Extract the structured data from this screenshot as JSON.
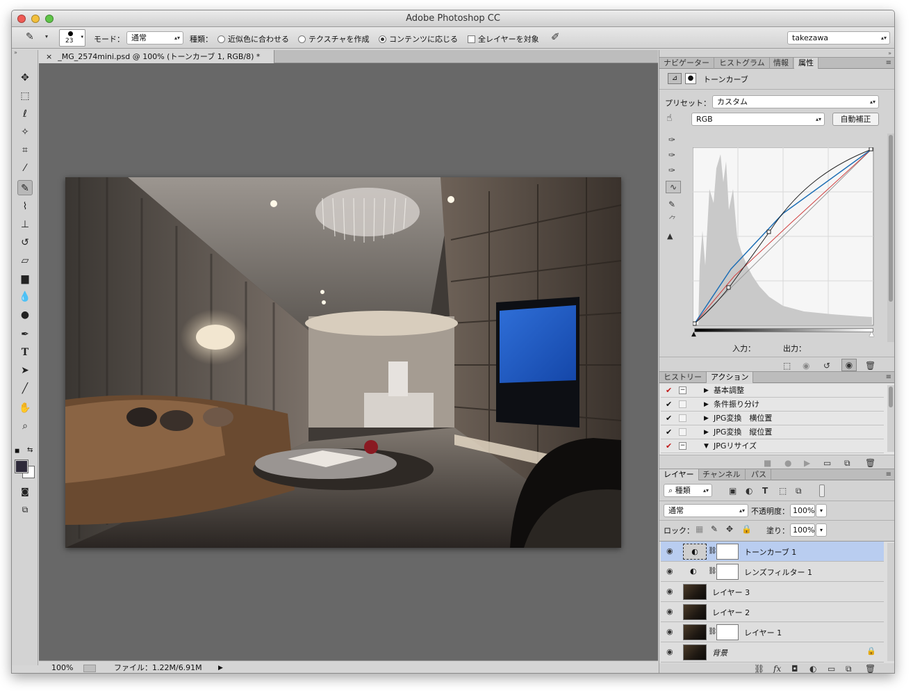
{
  "window": {
    "title": "Adobe Photoshop CC"
  },
  "options_bar": {
    "brush_size": "23",
    "mode_label": "モード：",
    "mode_value": "通常",
    "type_label": "種類：",
    "radio_1": "近似色に合わせる",
    "radio_2": "テクスチャを作成",
    "radio_3": "コンテンツに応じる",
    "selected_radio": 3,
    "all_layers_label": "全レイヤーを対象",
    "workspace": "takezawa"
  },
  "document": {
    "tab_title": "_MG_2574mini.psd @ 100% (トーンカーブ 1, RGB/8) *",
    "zoom": "100%",
    "file_info": "ファイル：1.22M/6.91M"
  },
  "properties_panel": {
    "tabs": [
      "ナビゲーター",
      "ヒストグラム",
      "情報",
      "属性"
    ],
    "active_tab": "属性",
    "adjustment_name": "トーンカーブ",
    "preset_label": "プリセット：",
    "preset_value": "カスタム",
    "channel_value": "RGB",
    "auto_button": "自動補正",
    "input_label": "入力：",
    "output_label": "出力："
  },
  "actions_panel": {
    "tabs": [
      "ヒストリー",
      "アクション"
    ],
    "active_tab": "アクション",
    "items": [
      {
        "label": "基本調整",
        "checked": true,
        "red": true
      },
      {
        "label": "条件振り分け",
        "checked": true,
        "red": false
      },
      {
        "label": "JPG変換　横位置",
        "checked": true,
        "red": false
      },
      {
        "label": "JPG変換　縦位置",
        "checked": true,
        "red": false
      },
      {
        "label": "JPGリサイズ",
        "checked": true,
        "red": true
      }
    ]
  },
  "layers_panel": {
    "tabs": [
      "レイヤー",
      "チャンネル",
      "パス"
    ],
    "active_tab": "レイヤー",
    "filter_label": "種類",
    "blend_mode": "通常",
    "opacity_label": "不透明度：",
    "opacity_value": "100%",
    "lock_label": "ロック：",
    "fill_label": "塗り：",
    "fill_value": "100%",
    "layers": [
      {
        "name": "トーンカーブ 1",
        "kind": "adjustment",
        "selected": true
      },
      {
        "name": "レンズフィルター 1",
        "kind": "adjustment",
        "selected": false
      },
      {
        "name": "レイヤー 3",
        "kind": "pixel",
        "selected": false
      },
      {
        "name": "レイヤー 2",
        "kind": "pixel",
        "selected": false
      },
      {
        "name": "レイヤー 1",
        "kind": "pixel-mask",
        "selected": false
      },
      {
        "name": "背景",
        "kind": "background",
        "selected": false
      }
    ]
  },
  "colors": {
    "curve_blue": "#1f6fb5",
    "curve_red": "#d04040",
    "selection": "#b9cdf0"
  }
}
